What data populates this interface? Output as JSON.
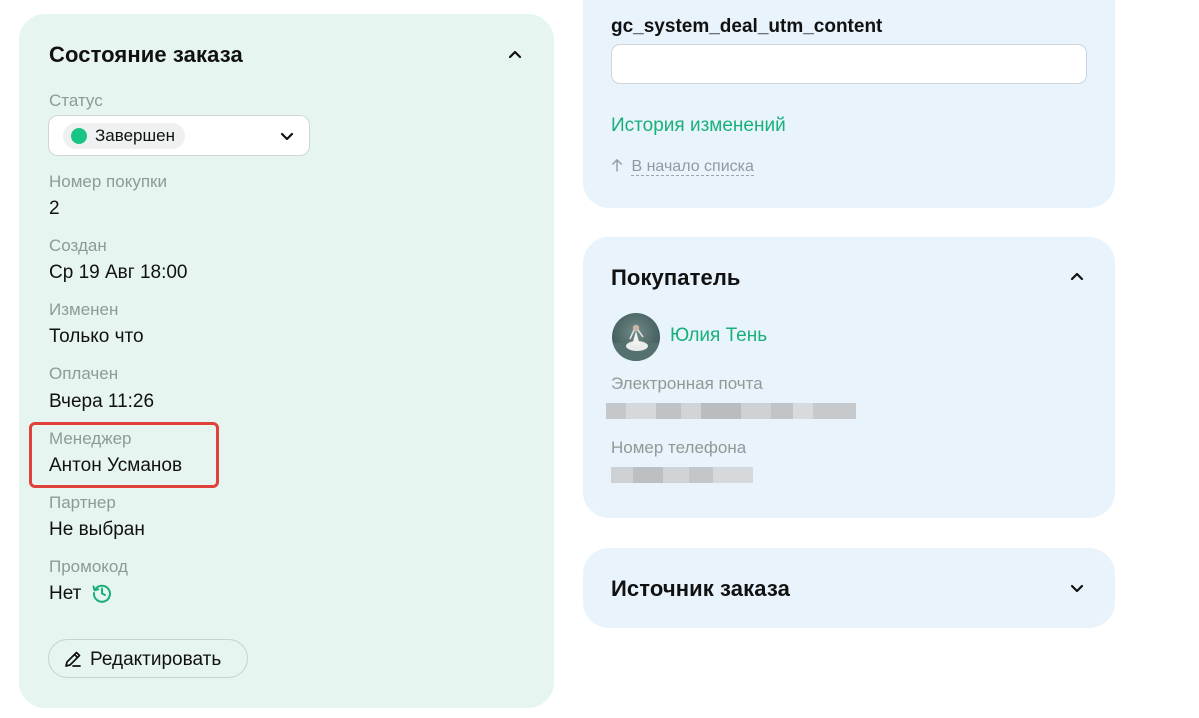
{
  "order_state": {
    "title": "Состояние заказа",
    "status_label": "Статус",
    "status_value": "Завершен",
    "status_color": "#19c486",
    "fields": [
      {
        "label": "Номер покупки",
        "value": "2"
      },
      {
        "label": "Создан",
        "value": "Ср 19 Авг 18:00"
      },
      {
        "label": "Изменен",
        "value": "Только что"
      },
      {
        "label": "Оплачен",
        "value": "Вчера 11:26"
      },
      {
        "label": "Менеджер",
        "value": "Антон Усманов"
      },
      {
        "label": "Партнер",
        "value": "Не выбран"
      },
      {
        "label": "Промокод",
        "value": "Нет"
      }
    ],
    "edit_button": "Редактировать",
    "highlight_color": "#e0413a"
  },
  "extra_fields": {
    "field_label": "gc_system_deal_utm_content",
    "field_value": "",
    "history_link": "История изменений",
    "back_to_top": "В начало списка"
  },
  "buyer": {
    "title": "Покупатель",
    "name": "Юлия Тень",
    "email_label": "Электронная почта",
    "phone_label": "Номер телефона"
  },
  "source": {
    "title": "Источник заказа"
  },
  "colors": {
    "accent_green": "#19b07a",
    "card_green": "#e6f5ef",
    "card_blue": "#e8f3fb"
  }
}
